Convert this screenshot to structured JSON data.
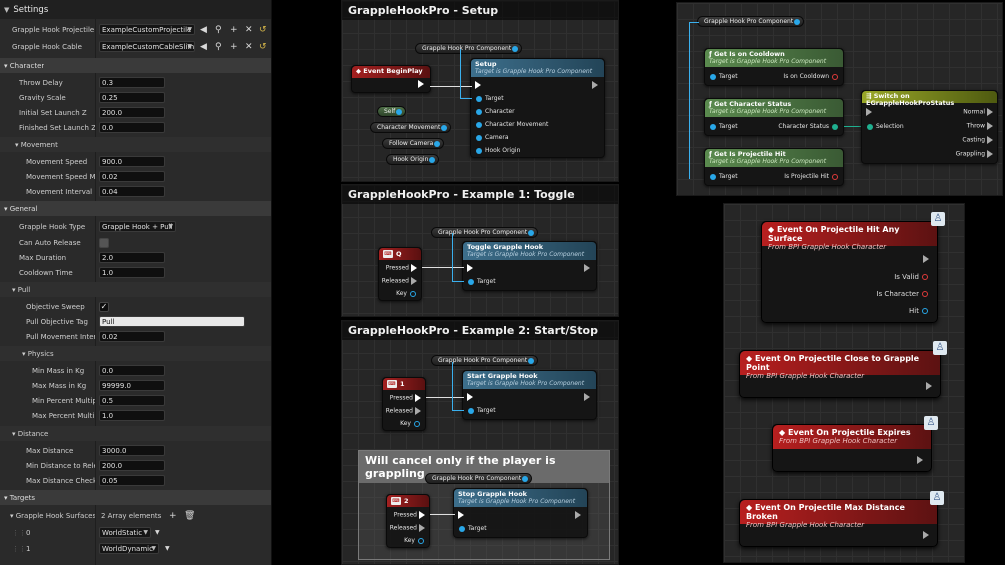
{
  "settings": {
    "title": "Settings",
    "top_rows": [
      {
        "label": "Grapple Hook Projectile",
        "value": "ExampleCustomProjectile"
      },
      {
        "label": "Grapple Hook Cable",
        "value": "ExampleCustomCableSlim"
      }
    ],
    "character": {
      "label": "Character",
      "rows": [
        {
          "label": "Throw Delay",
          "value": "0.3"
        },
        {
          "label": "Gravity Scale",
          "value": "0.25"
        },
        {
          "label": "Initial Set Launch Z",
          "value": "200.0"
        },
        {
          "label": "Finished Set Launch Z",
          "value": "0.0"
        }
      ],
      "movement": {
        "label": "Movement",
        "rows": [
          {
            "label": "Movement Speed",
            "value": "900.0"
          },
          {
            "label": "Movement Speed Mul",
            "value": "0.02"
          },
          {
            "label": "Movement Interval",
            "value": "0.04"
          }
        ]
      }
    },
    "general": {
      "label": "General",
      "type_label": "Grapple Hook Type",
      "type_value": "Grapple Hook + Pull",
      "can_auto_release": "Can Auto Release",
      "rows": [
        {
          "label": "Max Duration",
          "value": "2.0"
        },
        {
          "label": "Cooldown Time",
          "value": "1.0"
        }
      ]
    },
    "pull": {
      "label": "Pull",
      "objective_sweep": "Objective Sweep",
      "objective_tag_label": "Pull Objective Tag",
      "objective_tag_value": "Pull",
      "interval_label": "Pull Movement Interva",
      "interval_value": "0.02",
      "physics": {
        "label": "Physics",
        "rows": [
          {
            "label": "Min Mass in Kg",
            "value": "0.0"
          },
          {
            "label": "Max Mass in Kg",
            "value": "99999.0"
          },
          {
            "label": "Min Percent Multipli",
            "value": "0.5"
          },
          {
            "label": "Max Percent Multipl",
            "value": "1.0"
          }
        ]
      }
    },
    "distance": {
      "label": "Distance",
      "rows": [
        {
          "label": "Max Distance",
          "value": "3000.0"
        },
        {
          "label": "Min Distance to Relea",
          "value": "200.0"
        },
        {
          "label": "Max Distance Check I",
          "value": "0.05"
        }
      ]
    },
    "targets": {
      "label": "Targets",
      "surfaces_label": "Grapple Hook Surfaces",
      "surfaces_count": "2 Array elements",
      "items": [
        {
          "index": "0",
          "value": "WorldStatic"
        },
        {
          "index": "1",
          "value": "WorldDynamic"
        }
      ]
    }
  },
  "setup": {
    "title": "GrappleHookPro - Setup",
    "component": "Grapple Hook Pro Component",
    "event": "Event BeginPlay",
    "node_title": "Setup",
    "node_sub": "Target is Grapple Hook Pro Component",
    "pins": [
      "Target",
      "Character",
      "Character Movement",
      "Camera",
      "Hook Origin"
    ],
    "vars": [
      "Self",
      "Character Movement",
      "Follow Camera",
      "Hook Origin"
    ]
  },
  "example1": {
    "title": "GrappleHookPro - Example 1: Toggle",
    "component": "Grapple Hook Pro Component",
    "key": "Q",
    "node_title": "Toggle Grapple Hook",
    "node_sub": "Target is Grapple Hook Pro Component",
    "pins": [
      "Pressed",
      "Released",
      "Key"
    ],
    "target": "Target"
  },
  "example2": {
    "title": "GrappleHookPro - Example 2: Start/Stop",
    "component": "Grapple Hook Pro Component",
    "key": "1",
    "node_title": "Start Grapple Hook",
    "node_sub": "Target is Grapple Hook Pro Component",
    "pins": [
      "Pressed",
      "Released",
      "Key"
    ],
    "target": "Target",
    "comment": "Will cancel only if the player is grappling",
    "component2": "Grapple Hook Pro Component",
    "key2": "2",
    "node2_title": "Stop Grapple Hook",
    "node2_sub": "Target is Grapple Hook Pro Component",
    "target2": "Target"
  },
  "status": {
    "component": "Grapple Hook Pro Component",
    "nodes": [
      {
        "title": "Get Is on Cooldown",
        "sub": "Target is Grapple Hook Pro Component",
        "in": "Target",
        "out": "Is on Cooldown"
      },
      {
        "title": "Get Character Status",
        "sub": "Target is Grapple Hook Pro Component",
        "in": "Target",
        "out": "Character Status"
      },
      {
        "title": "Get Is Projectile Hit",
        "sub": "Target is Grapple Hook Pro Component",
        "in": "Target",
        "out": "Is Projectile Hit"
      }
    ],
    "switch_title": "Switch on EGrappleHookProStatus",
    "switch_in": "Selection",
    "switch_outs": [
      "Normal",
      "Throw",
      "Casting",
      "Grappling"
    ]
  },
  "events": [
    {
      "title": "Event On Projectile Hit Any Surface",
      "sub": "From BPI Grapple Hook Character",
      "pins": [
        "Is Valid",
        "Is Character",
        "Hit"
      ]
    },
    {
      "title": "Event On Projectile Close to Grapple Point",
      "sub": "From BPI Grapple Hook Character",
      "pins": []
    },
    {
      "title": "Event On Projectile Expires",
      "sub": "From BPI Grapple Hook Character",
      "pins": []
    },
    {
      "title": "Event On Projectile Max Distance Broken",
      "sub": "From BPI Grapple Hook Character",
      "pins": []
    }
  ]
}
